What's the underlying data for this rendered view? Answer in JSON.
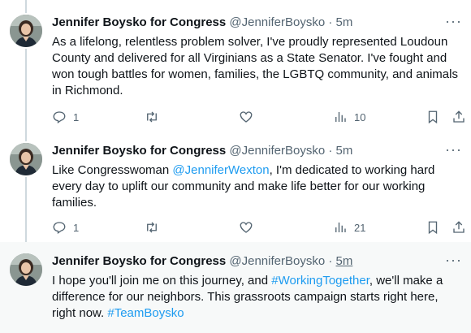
{
  "tweets": [
    {
      "name": "Jennifer Boysko for Congress",
      "handle": "@JenniferBoysko",
      "sep": "·",
      "time": "5m",
      "text": "As a lifelong, relentless problem solver, I've proudly represented Loudoun County and delivered for all Virginians as a State Senator. I've fought and won tough battles for women, families, the LGBTQ community, and animals in Richmond.",
      "replies": "1",
      "retweets": "",
      "likes": "",
      "views": "10"
    },
    {
      "name": "Jennifer Boysko for Congress",
      "handle": "@JenniferBoysko",
      "sep": "·",
      "time": "5m",
      "text_parts": [
        "Like Congresswoman ",
        "@JenniferWexton",
        ", I'm dedicated to working hard every day to uplift our community and make life better for our working families."
      ],
      "replies": "1",
      "retweets": "",
      "likes": "",
      "views": "21"
    },
    {
      "name": "Jennifer Boysko for Congress",
      "handle": "@JenniferBoysko",
      "sep": "·",
      "time": "5m",
      "text_parts": [
        "I hope you'll join me on this journey, and ",
        "#WorkingTogether",
        ", we'll make a difference for our neighbors. This grassroots campaign starts right here, right now. ",
        "#TeamBoysko"
      ]
    }
  ],
  "colors": {
    "link": "#1d9bf0",
    "secondary_text": "#536471",
    "thread_line": "#cfd9de",
    "highlight_bg": "#f7f9f9"
  },
  "icons": [
    "reply-icon",
    "retweet-icon",
    "like-icon",
    "views-icon",
    "bookmark-icon",
    "share-icon",
    "more-icon"
  ]
}
